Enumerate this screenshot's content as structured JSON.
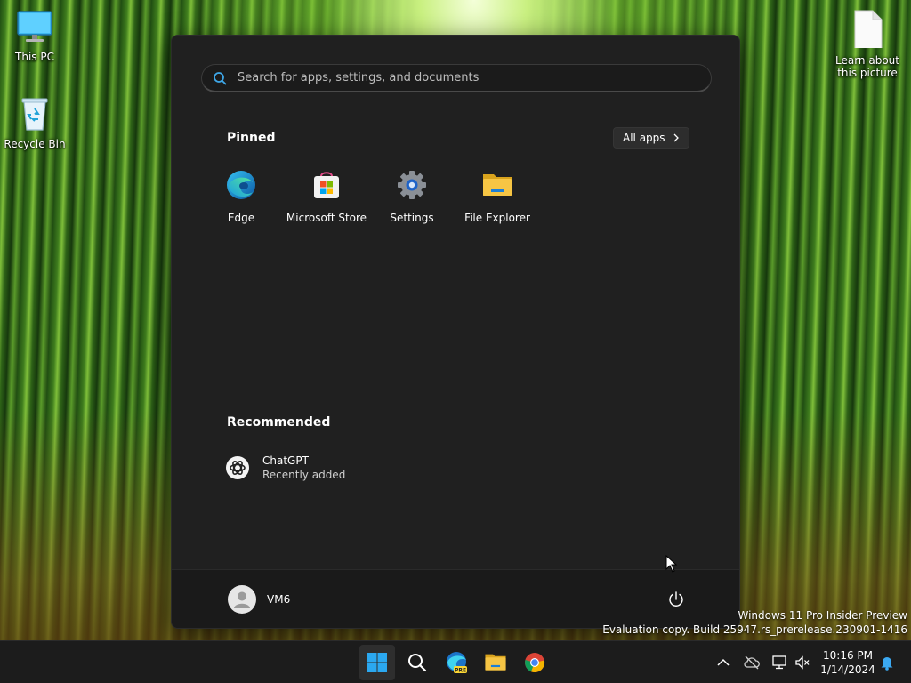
{
  "desktop": {
    "icons": [
      {
        "label": "This PC"
      },
      {
        "label": "Recycle Bin"
      },
      {
        "label": "Learn about this picture"
      }
    ]
  },
  "start_menu": {
    "search": {
      "placeholder": "Search for apps, settings, and documents"
    },
    "pinned": {
      "title": "Pinned",
      "all_apps_label": "All apps",
      "apps": [
        {
          "label": "Edge",
          "icon": "edge-icon"
        },
        {
          "label": "Microsoft Store",
          "icon": "store-icon"
        },
        {
          "label": "Settings",
          "icon": "gear-icon"
        },
        {
          "label": "File Explorer",
          "icon": "folder-icon"
        }
      ]
    },
    "recommended": {
      "title": "Recommended",
      "items": [
        {
          "title": "ChatGPT",
          "subtitle": "Recently added",
          "icon": "chatgpt-icon"
        }
      ]
    },
    "user": {
      "name": "VM6"
    },
    "power_icon": "power-icon"
  },
  "watermark": {
    "line1": "Windows 11 Pro Insider Preview",
    "line2": "Evaluation copy. Build 25947.rs_prerelease.230901-1416"
  },
  "taskbar": {
    "apps": [
      "windows-start-icon",
      "search-icon",
      "edge-beta-icon",
      "folder-icon",
      "chrome-icon"
    ],
    "clock": {
      "time": "10:16 PM",
      "date": "1/14/2024"
    },
    "colors": {
      "accent": "#0078d4",
      "edge_blue": "#1fa0e3",
      "folder_yellow": "#f6c544"
    }
  }
}
